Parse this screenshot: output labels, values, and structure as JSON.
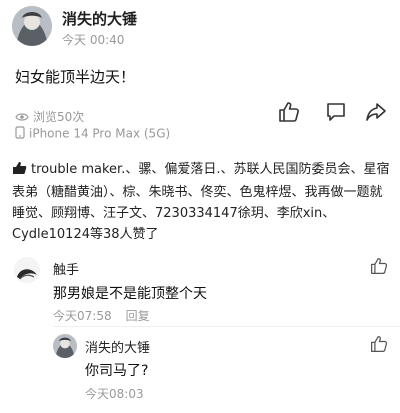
{
  "post": {
    "author": "消失的大锤",
    "time": "今天 00:40",
    "content": "妇女能顶半边天！",
    "views": "浏览50次",
    "device": "iPhone 14 Pro Max (5G)"
  },
  "actions": {
    "like_icon": "thumb-up-icon",
    "comment_icon": "comment-icon",
    "share_icon": "share-icon"
  },
  "likes": {
    "text": "trouble maker.、骡、偏爱落日.、苏联人民国防委员会、星宿表弟（糖醋黄油）、棕、朱晓书、佟奕、色鬼梓煜、我再做一题就睡觉、顾翔博、汪子文、7230334147徐玥、李欣xin、Cydle10124等38人赞了"
  },
  "comments": [
    {
      "name": "触手",
      "text": "那男娘是不是能顶整个天",
      "time": "今天07:58",
      "reply_label": "回复"
    }
  ],
  "reply": {
    "name": "消失的大锤",
    "text": "你司马了?",
    "time": "今天08:03"
  },
  "colors": {
    "meta_gray": "#9a9a9a",
    "text_dark": "#111111"
  }
}
